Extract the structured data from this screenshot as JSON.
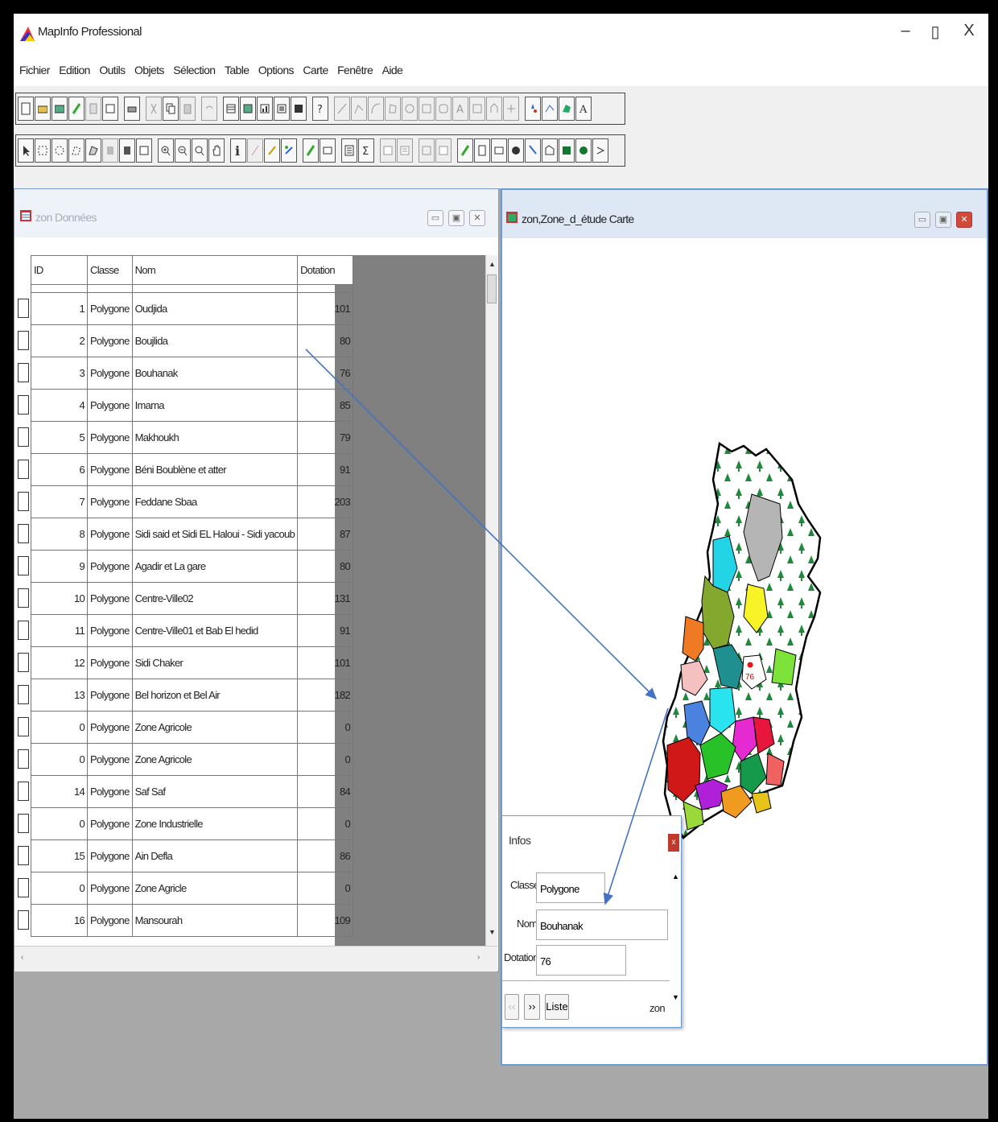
{
  "app": {
    "title": "MapInfo Professional",
    "window_controls": {
      "minimize": "–",
      "restore": "▯",
      "close": "X"
    }
  },
  "menu": [
    "Fichier",
    "Edition",
    "Outils",
    "Objets",
    "Sélection",
    "Table",
    "Options",
    "Carte",
    "Fenêtre",
    "Aide"
  ],
  "data_window": {
    "title": "zon Données",
    "columns": [
      "ID",
      "Classe",
      "Nom",
      "Dotation"
    ],
    "rows": [
      {
        "id": "1",
        "classe": "Polygone",
        "nom": "Oudjida",
        "dotation": "101"
      },
      {
        "id": "2",
        "classe": "Polygone",
        "nom": "Boujlida",
        "dotation": "80"
      },
      {
        "id": "3",
        "classe": "Polygone",
        "nom": "Bouhanak",
        "dotation": "76"
      },
      {
        "id": "4",
        "classe": "Polygone",
        "nom": "Imama",
        "dotation": "85"
      },
      {
        "id": "5",
        "classe": "Polygone",
        "nom": "Makhoukh",
        "dotation": "79"
      },
      {
        "id": "6",
        "classe": "Polygone",
        "nom": "Béni Boublène et atter",
        "dotation": "91"
      },
      {
        "id": "7",
        "classe": "Polygone",
        "nom": "Feddane Sbaa",
        "dotation": "203"
      },
      {
        "id": "8",
        "classe": "Polygone",
        "nom": "Sidi said et Sidi EL Haloui - Sidi yacoub",
        "dotation": "87"
      },
      {
        "id": "9",
        "classe": "Polygone",
        "nom": "Agadir et La gare",
        "dotation": "80"
      },
      {
        "id": "10",
        "classe": "Polygone",
        "nom": "Centre-Ville02",
        "dotation": "131"
      },
      {
        "id": "11",
        "classe": "Polygone",
        "nom": "Centre-Ville01 et Bab El hedid",
        "dotation": "91"
      },
      {
        "id": "12",
        "classe": "Polygone",
        "nom": "Sidi Chaker",
        "dotation": "101"
      },
      {
        "id": "13",
        "classe": "Polygone",
        "nom": "Bel horizon et Bel Air",
        "dotation": "182"
      },
      {
        "id": "0",
        "classe": "Polygone",
        "nom": "Zone Agricole",
        "dotation": "0"
      },
      {
        "id": "0",
        "classe": "Polygone",
        "nom": "Zone Agricole",
        "dotation": "0"
      },
      {
        "id": "14",
        "classe": "Polygone",
        "nom": "Saf Saf",
        "dotation": "84"
      },
      {
        "id": "0",
        "classe": "Polygone",
        "nom": "Zone Industrielle",
        "dotation": "0"
      },
      {
        "id": "15",
        "classe": "Polygone",
        "nom": "Ain Defla",
        "dotation": "86"
      },
      {
        "id": "0",
        "classe": "Polygone",
        "nom": "Zone Agricle",
        "dotation": "0"
      },
      {
        "id": "16",
        "classe": "Polygone",
        "nom": "Mansourah",
        "dotation": "109"
      }
    ]
  },
  "map_window": {
    "title": "zon,Zone_d_étude Carte",
    "map_label": "76"
  },
  "info_window": {
    "title": "Infos",
    "fields": [
      {
        "label": "Classe:",
        "value": "Polygone"
      },
      {
        "label": "Nom:",
        "value": "Bouhanak"
      },
      {
        "label": "Dotation:",
        "value": "76"
      }
    ],
    "buttons": {
      "prev": "‹‹",
      "next": "››",
      "list": "Liste"
    },
    "table_name": "zon"
  },
  "colors": {
    "accent": "#4a7ab8",
    "arrow": "#4472c4",
    "grid_bg": "#808080"
  }
}
